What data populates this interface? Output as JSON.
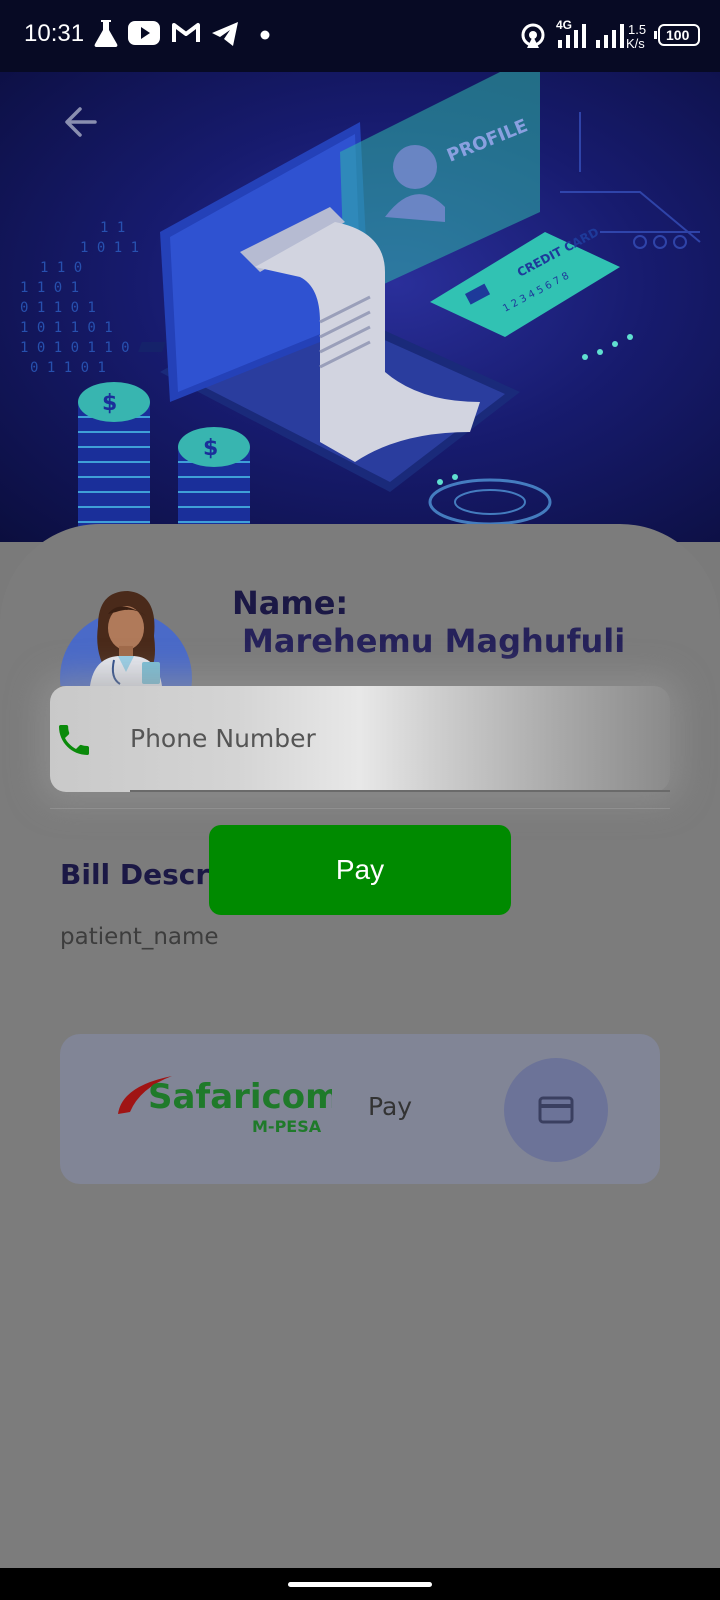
{
  "status_bar": {
    "time": "10:31",
    "network_type": "4G",
    "speed_value": "1.5",
    "speed_unit": "K/s",
    "battery": "100",
    "icons": [
      "flask-icon",
      "youtube-icon",
      "gmail-icon",
      "telegram-icon",
      "dot-icon",
      "hotspot-icon",
      "signal-icon",
      "signal-icon-2",
      "battery-icon"
    ]
  },
  "hero": {
    "illustration": "payment-illustration",
    "profile_text": "PROFILE",
    "credit_card_text": "CREDIT CARD",
    "card_number": "1 2 3 4 5 6 7 8"
  },
  "profile": {
    "name_label": "Name:",
    "name_value": "Marehemu Maghufuli"
  },
  "phone_dialog": {
    "placeholder": "Phone Number",
    "pay_label": "Pay"
  },
  "bill": {
    "title": "Bill Description",
    "value": "patient_name"
  },
  "mpesa": {
    "brand": "Safaricom",
    "sub_brand": "M-PESA",
    "pay_label": "Pay"
  },
  "colors": {
    "pay_button": "#008a00",
    "phone_icon": "#0a8a0a",
    "safaricom_green": "#1f8a2a",
    "safaricom_red": "#b01010"
  }
}
